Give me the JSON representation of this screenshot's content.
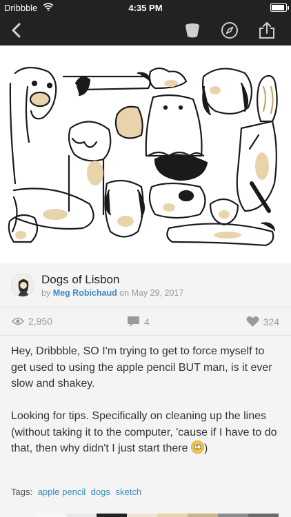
{
  "status_bar": {
    "carrier": "Dribbble",
    "time": "4:35 PM"
  },
  "nav_bar": {
    "back_icon": "chevron-left-icon",
    "bucket_icon": "bucket-icon",
    "explore_icon": "compass-icon",
    "share_icon": "share-icon"
  },
  "shot": {
    "title": "Dogs of Lisbon",
    "by_prefix": "by",
    "author": "Meg Robichaud",
    "on_prefix": "on",
    "date": "May 29, 2017",
    "illustration": "Line drawing of many cartoon dogs with beige spots"
  },
  "stats": {
    "views": "2,950",
    "comments": "4",
    "likes": "324"
  },
  "description": {
    "paragraph1": "Hey, Dribbble, SO I'm trying to get to force myself to get used to using the apple pencil BUT man, is it ever slow and shakey.",
    "paragraph2": "Looking for tips. Specifically on cleaning up the lines (without taking it to the computer, 'cause if I have to do that, then why didn't I just start there",
    "paragraph2_end": ")"
  },
  "tags": {
    "label": "Tags:",
    "items": [
      "apple pencil",
      "dogs",
      "sketch"
    ]
  },
  "palette": [
    "#f8f8f6",
    "#e9e9e7",
    "#222222",
    "#efe4d2",
    "#e8d3ab",
    "#c9b58a",
    "#8e8e8e",
    "#6b6b6b"
  ],
  "colors": {
    "nav_bg": "#222222",
    "link": "#3a8bbb",
    "spot": "#e8d3ab"
  }
}
